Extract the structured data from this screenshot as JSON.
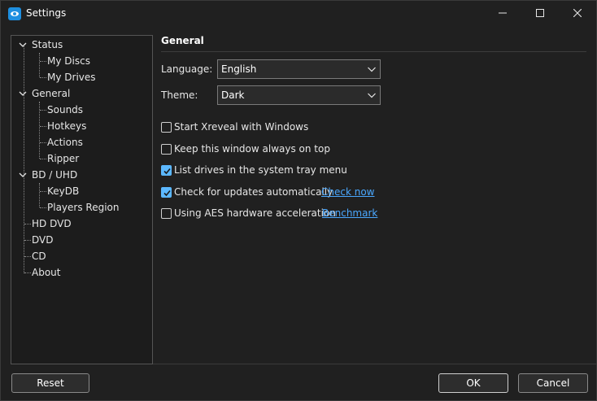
{
  "window": {
    "title": "Settings"
  },
  "tree": {
    "items": [
      {
        "label": "Status",
        "level": 0,
        "expanded": true
      },
      {
        "label": "My Discs",
        "level": 1
      },
      {
        "label": "My Drives",
        "level": 1
      },
      {
        "label": "General",
        "level": 0,
        "expanded": true,
        "selected": true
      },
      {
        "label": "Sounds",
        "level": 1
      },
      {
        "label": "Hotkeys",
        "level": 1
      },
      {
        "label": "Actions",
        "level": 1
      },
      {
        "label": "Ripper",
        "level": 1
      },
      {
        "label": "BD / UHD",
        "level": 0,
        "expanded": true
      },
      {
        "label": "KeyDB",
        "level": 1
      },
      {
        "label": "Players Region",
        "level": 1
      },
      {
        "label": "HD DVD",
        "level": 0
      },
      {
        "label": "DVD",
        "level": 0
      },
      {
        "label": "CD",
        "level": 0
      },
      {
        "label": "About",
        "level": 0
      }
    ]
  },
  "general": {
    "title": "General",
    "language_label": "Language:",
    "language_value": "English",
    "theme_label": "Theme:",
    "theme_value": "Dark",
    "options": [
      {
        "label": "Start Xreveal with Windows",
        "checked": false
      },
      {
        "label": "Keep this window always on top",
        "checked": false
      },
      {
        "label": "List drives in the system tray menu",
        "checked": true
      },
      {
        "label": "Check for updates automatically",
        "checked": true,
        "link": "Check now"
      },
      {
        "label": "Using AES hardware acceleration",
        "checked": false,
        "link": "Benchmark"
      }
    ]
  },
  "buttons": {
    "reset": "Reset",
    "ok": "OK",
    "cancel": "Cancel"
  },
  "colors": {
    "accent": "#5cb8ff",
    "link": "#4aa8ff",
    "background": "#202020"
  }
}
